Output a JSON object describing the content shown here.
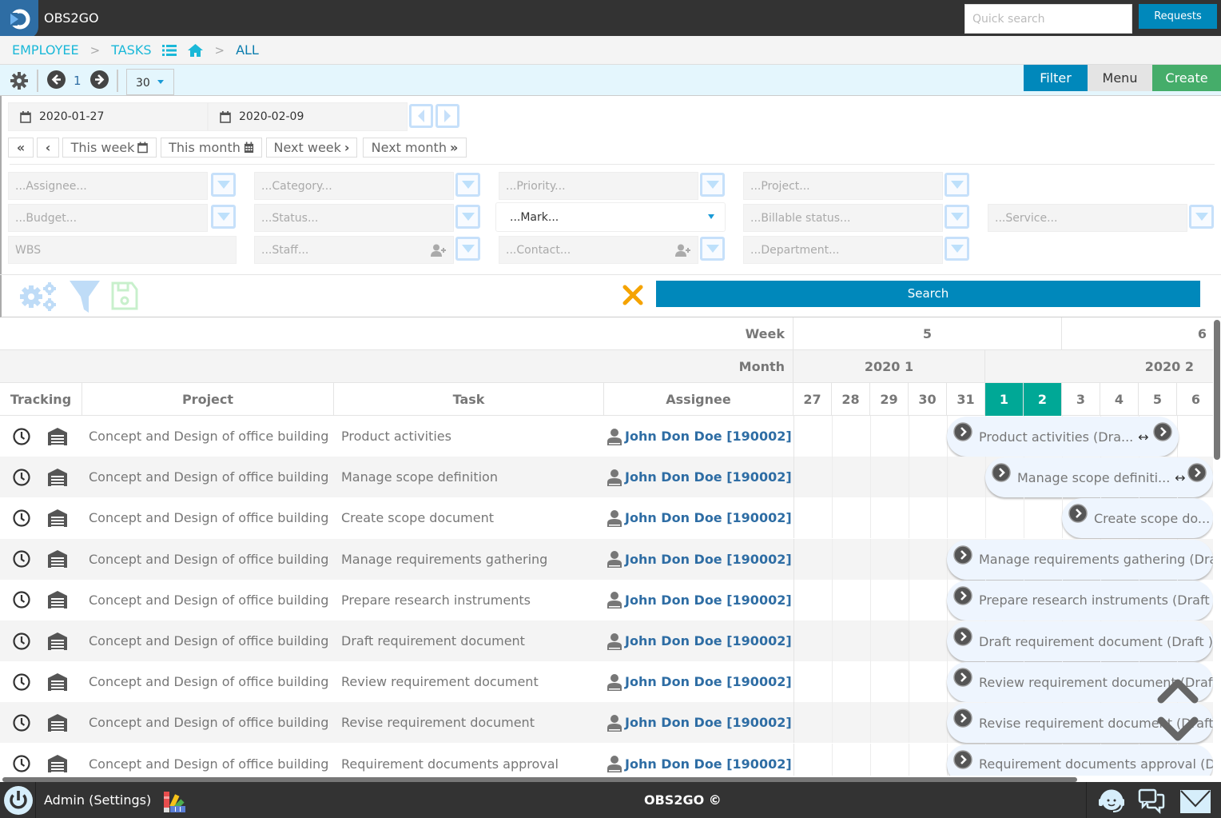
{
  "app": {
    "title": "OBS2GO",
    "logo_icon": "obs2go-logo-icon"
  },
  "header": {
    "quick_search_placeholder": "Quick search",
    "quick_search_value": "",
    "requests_label": "Requests"
  },
  "breadcrumb": {
    "items": [
      {
        "label": "EMPLOYEE"
      },
      {
        "label": "TASKS"
      },
      {
        "label": "ALL"
      }
    ],
    "separator": ">",
    "list_icon": "list-icon",
    "home_icon": "home-icon"
  },
  "toolbar": {
    "settings_icon": "gear-icon",
    "page": "1",
    "per_page": "30",
    "filter_label": "Filter",
    "menu_label": "Menu",
    "create_label": "Create"
  },
  "filters": {
    "date_from": "2020-01-27",
    "date_to": "2020-02-09",
    "quick": {
      "first": "«",
      "prev": "‹",
      "this_week": "This week",
      "this_month": "This month",
      "next_week": "Next week",
      "next_month": "Next month"
    },
    "fields": {
      "assignee": "...Assignee...",
      "category": "...Category...",
      "priority": "...Priority...",
      "project": "...Project...",
      "budget": "...Budget...",
      "status": "...Status...",
      "mark": "...Mark...",
      "billable_status": "...Billable status...",
      "service": "...Service...",
      "wbs": "WBS",
      "staff": "...Staff...",
      "contact": "...Contact...",
      "department": "...Department..."
    },
    "search_label": "Search",
    "clear_icon": "close-icon"
  },
  "colors": {
    "primary": "#0088bb",
    "create": "#45ad6a",
    "today": "#00a896",
    "link": "#2e6da4",
    "breadcrumb": "#1ab8d8",
    "clear": "#f5a300"
  },
  "grid": {
    "week_label": "Week",
    "month_label": "Month",
    "weeks": [
      {
        "label": "5"
      },
      {
        "label": "6"
      }
    ],
    "months": [
      {
        "label": "2020 1"
      },
      {
        "label": "2020 2"
      }
    ],
    "columns": {
      "tracking": "Tracking",
      "project": "Project",
      "task": "Task",
      "assignee": "Assignee"
    },
    "days": [
      {
        "label": "27",
        "highlight": false
      },
      {
        "label": "28",
        "highlight": false
      },
      {
        "label": "29",
        "highlight": false
      },
      {
        "label": "30",
        "highlight": false
      },
      {
        "label": "31",
        "highlight": false
      },
      {
        "label": "1",
        "highlight": true
      },
      {
        "label": "2",
        "highlight": true
      },
      {
        "label": "3",
        "highlight": false
      },
      {
        "label": "4",
        "highlight": false
      },
      {
        "label": "5",
        "highlight": false
      },
      {
        "label": "6",
        "highlight": false
      }
    ],
    "rows": [
      {
        "project": "Concept and Design of office building",
        "task": "Product activities",
        "assignee": "John Don Doe [190002]",
        "bar": "Product activities (Dra...",
        "bar_resizable": true
      },
      {
        "project": "Concept and Design of office building",
        "task": "Manage scope definition",
        "assignee": "John Don Doe [190002]",
        "bar": "Manage scope definiti...",
        "bar_resizable": true
      },
      {
        "project": "Concept and Design of office building",
        "task": "Create scope document",
        "assignee": "John Don Doe [190002]",
        "bar": "Create scope do...",
        "bar_resizable": false
      },
      {
        "project": "Concept and Design of office building",
        "task": "Manage requirements gathering",
        "assignee": "John Don Doe [190002]",
        "bar": "Manage requirements gathering (Draft )",
        "bar_resizable": false
      },
      {
        "project": "Concept and Design of office building",
        "task": "Prepare research instruments",
        "assignee": "John Don Doe [190002]",
        "bar": "Prepare research instruments (Draft )",
        "bar_resizable": false
      },
      {
        "project": "Concept and Design of office building",
        "task": "Draft requirement document",
        "assignee": "John Don Doe [190002]",
        "bar": "Draft requirement document (Draft )",
        "bar_resizable": false
      },
      {
        "project": "Concept and Design of office building",
        "task": "Review requirement document",
        "assignee": "John Don Doe [190002]",
        "bar": "Review requirement document (Draft )",
        "bar_resizable": false
      },
      {
        "project": "Concept and Design of office building",
        "task": "Revise requirement document",
        "assignee": "John Don Doe [190002]",
        "bar": "Revise requirement document (Draft )",
        "bar_resizable": false
      },
      {
        "project": "Concept and Design of office building",
        "task": "Requirement documents approval",
        "assignee": "John Don Doe [190002]",
        "bar": "Requirement documents approval (Draft )",
        "bar_resizable": false
      }
    ]
  },
  "footer": {
    "admin_label": "Admin (Settings)",
    "brand": "OBS2GO ©",
    "power_icon": "power-icon",
    "palette_icon": "color-palette-icon",
    "support_icon": "support-agent-icon",
    "chat_icon": "chat-icon",
    "mail_icon": "mail-icon"
  }
}
